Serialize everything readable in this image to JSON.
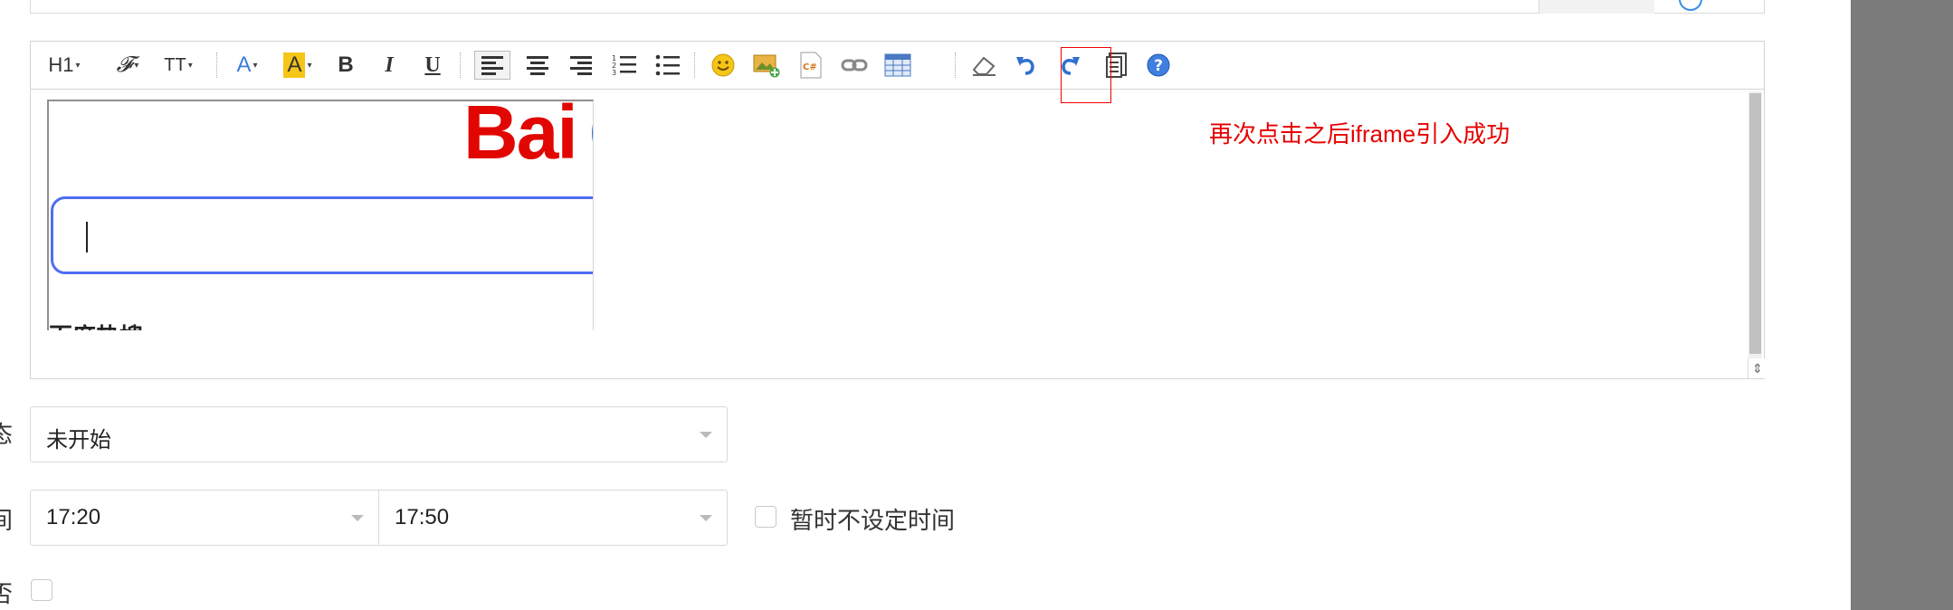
{
  "toolbar": {
    "heading": "H1",
    "font_family": "𝓕",
    "font_size": "TT",
    "font_color": "A",
    "highlight": "A",
    "bold": "B",
    "italic": "I",
    "underline": "U"
  },
  "editor": {
    "iframe_logo": "Bai",
    "iframe_hot": "百度热搜 ›",
    "annotation": "再次点击之后iframe引入成功"
  },
  "form": {
    "status_label": "态",
    "status_value": "未开始",
    "time_label": "间",
    "time_start": "17:20",
    "time_end": "17:50",
    "no_time_label": "暂时不设定时间",
    "last_label": "否"
  },
  "colors": {
    "annotation": "#e60000",
    "accent": "#4e6ef2",
    "logo": "#e10601"
  }
}
